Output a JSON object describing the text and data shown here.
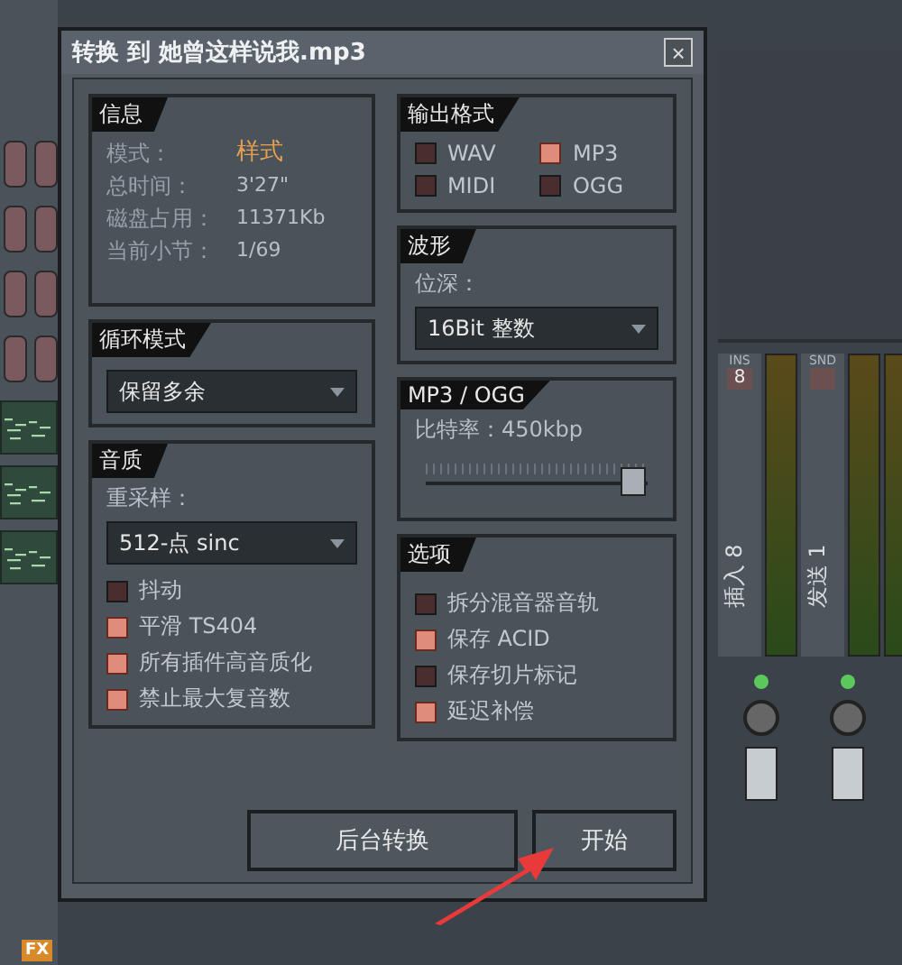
{
  "dialog": {
    "title": "转换 到 她曾这样说我.mp3",
    "close": "×"
  },
  "info": {
    "heading": "信息",
    "rows": [
      {
        "label": "模式：",
        "value": "样式",
        "kind": "highlight"
      },
      {
        "label": "总时间：",
        "value": "3'27\"",
        "kind": "plain"
      },
      {
        "label": "磁盘占用：",
        "value": "11371Kb",
        "kind": "plain"
      },
      {
        "label": "当前小节：",
        "value": "1/69",
        "kind": "plain"
      }
    ]
  },
  "loop_mode": {
    "heading": "循环模式",
    "value": "保留多余"
  },
  "quality": {
    "heading": "音质",
    "resample_label": "重采样：",
    "resample_value": "512-点 sinc",
    "options": [
      {
        "label": "抖动",
        "checked": false
      },
      {
        "label": "平滑 TS404",
        "checked": true
      },
      {
        "label": "所有插件高音质化",
        "checked": true
      },
      {
        "label": "禁止最大复音数",
        "checked": true
      }
    ]
  },
  "output_format": {
    "heading": "输出格式",
    "formats": [
      {
        "label": "WAV",
        "checked": false
      },
      {
        "label": "MP3",
        "checked": true
      },
      {
        "label": "MIDI",
        "checked": false
      },
      {
        "label": "OGG",
        "checked": false
      }
    ]
  },
  "waveform": {
    "heading": "波形",
    "depth_label": "位深：",
    "depth_value": "16Bit 整数"
  },
  "mp3_ogg": {
    "heading": "MP3 / OGG",
    "bitrate": "比特率：450kbp",
    "level": 0.93
  },
  "options": {
    "heading": "选项",
    "items": [
      {
        "label": "拆分混音器音轨",
        "checked": false
      },
      {
        "label": "保存 ACID",
        "checked": true
      },
      {
        "label": "保存切片标记",
        "checked": false
      },
      {
        "label": "延迟补偿",
        "checked": true
      }
    ]
  },
  "buttons": [
    {
      "label": "后台转换"
    },
    {
      "label": "开始"
    }
  ],
  "mixer": {
    "tracks": [
      {
        "tag": "INS",
        "number": "8",
        "name": "插入 8"
      },
      {
        "tag": "SND",
        "name": "发送 1"
      }
    ]
  },
  "left_strip": {
    "fx_label": "FX"
  }
}
